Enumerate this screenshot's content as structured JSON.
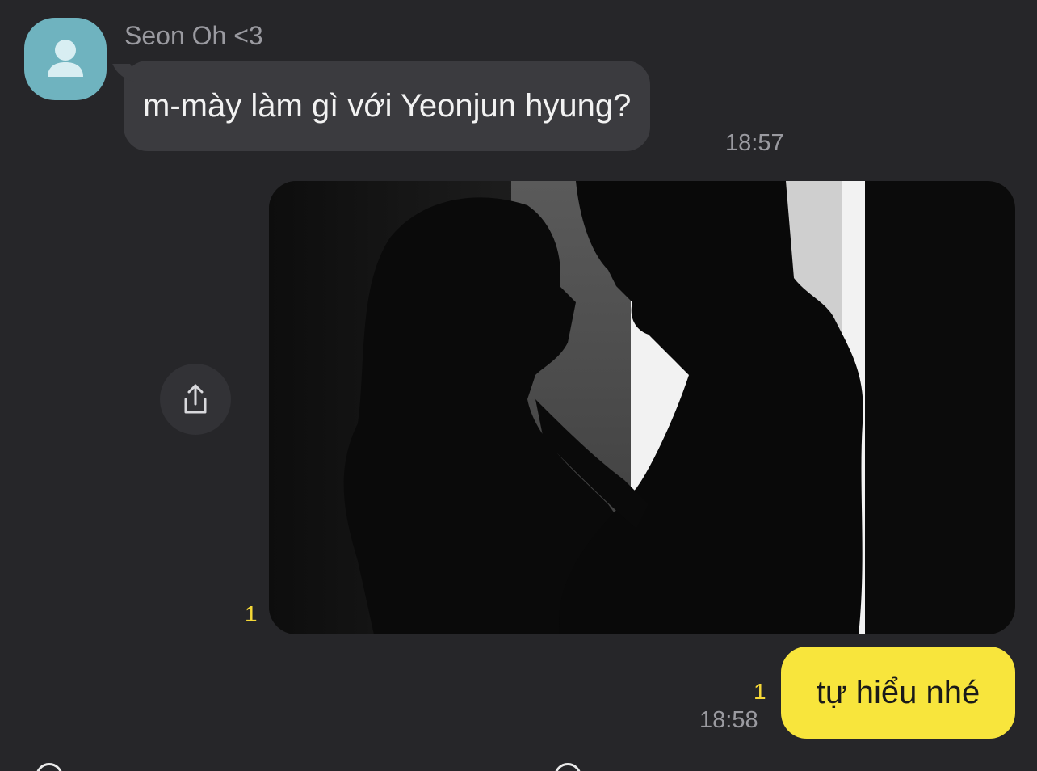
{
  "conversation": {
    "contact_name": "Seon Oh <3",
    "avatar_icon": "person-icon",
    "avatar_color": "#6fb3bf"
  },
  "messages": [
    {
      "direction": "incoming",
      "type": "text",
      "text": "m-mày làm gì với Yeonjun hyung?",
      "time": "18:57"
    },
    {
      "direction": "outgoing",
      "type": "image",
      "unread_count": "1",
      "share_icon": "share-icon"
    },
    {
      "direction": "outgoing",
      "type": "text",
      "text": "tự hiểu nhé",
      "unread_count": "1",
      "time": "18:58"
    }
  ],
  "colors": {
    "background": "#262629",
    "incoming_bubble": "#3b3b3f",
    "outgoing_bubble": "#f8e53c",
    "unread": "#f5d837"
  }
}
